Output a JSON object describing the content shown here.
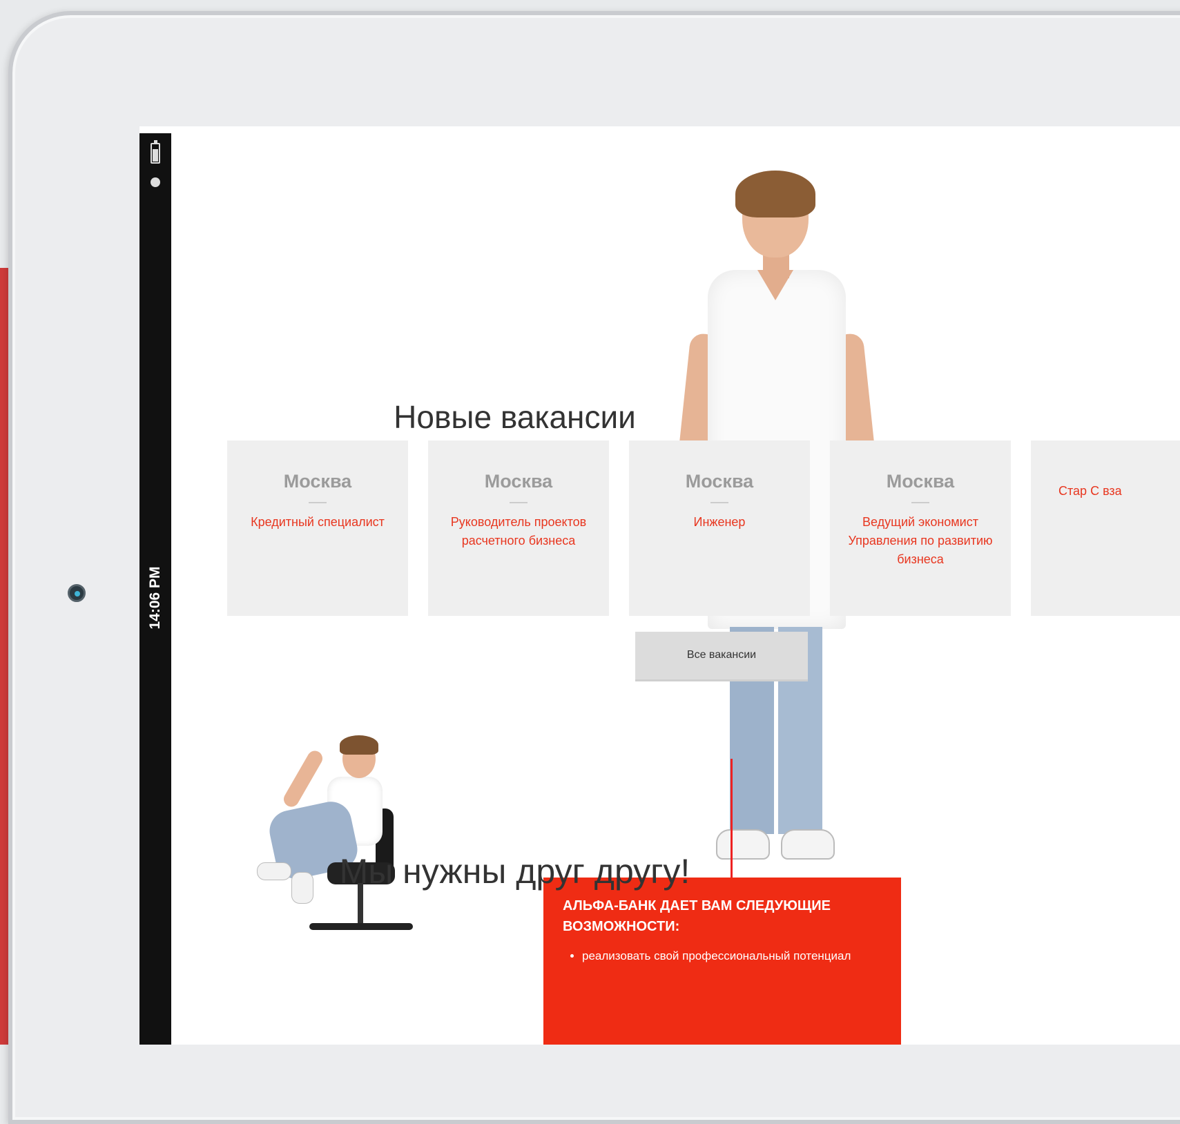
{
  "status": {
    "time": "14:06 PM"
  },
  "vacancies": {
    "title": "Новые вакансии",
    "cards": [
      {
        "city": "Москва",
        "job": "Кредитный специалист"
      },
      {
        "city": "Москва",
        "job": "Руководитель проектов расчетного бизнеса"
      },
      {
        "city": "Москва",
        "job": "Инженер"
      },
      {
        "city": "Москва",
        "job": "Ведущий экономист Управления по развитию бизнеса"
      },
      {
        "city": "",
        "job": "Стар С вза"
      }
    ],
    "all_button": "Все вакансии"
  },
  "we_need": {
    "title": "Мы нужны друг другу!",
    "box_title": "АЛЬФА-БАНК ДАЕТ ВАМ СЛЕДУЮЩИЕ ВОЗМОЖНОСТИ:",
    "items": [
      "реализовать свой профессиональный потенциал"
    ]
  },
  "colors": {
    "accent": "#ef2c14",
    "card_bg": "#efefef",
    "link": "#e8361f"
  }
}
